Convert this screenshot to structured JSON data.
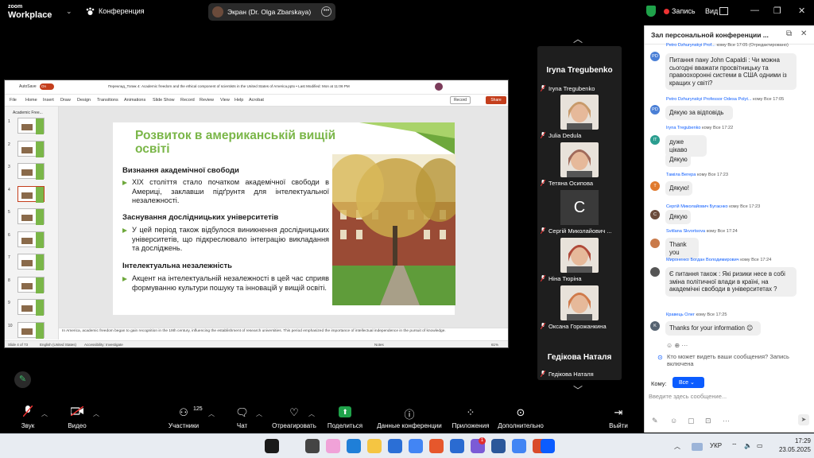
{
  "zoom": {
    "logo_top": "zoom",
    "logo_bottom": "Workplace",
    "meeting_label": "Конференция",
    "screen_share_label": "Экран (Dr. Olga Zbarskaya)",
    "recording_label": "Запись",
    "view_label": "Вид",
    "colors": {
      "accent": "#0b5cff",
      "green": "#1fa24a",
      "record": "#e33333"
    }
  },
  "powerpoint": {
    "autosave": "AutoSave",
    "autosave_state": "On",
    "file_title": "Переклад_Топик 4: Academic freedom and the ethical component of scientists in the United States of America.pptx • Last Modified: Mon at 11:06 PM",
    "menu": [
      "File",
      "Home",
      "Insert",
      "Draw",
      "Design",
      "Transitions",
      "Animations",
      "Slide Show",
      "Record",
      "Review",
      "View",
      "Help",
      "Acrobat"
    ],
    "record_btn": "Record",
    "share_btn": "Share",
    "pane_title": "Academic Free...",
    "slide_numbers": [
      "1",
      "2",
      "3",
      "4",
      "5",
      "6",
      "7",
      "8",
      "9",
      "10"
    ],
    "selected_slide": 4,
    "notes": "In America, academic freedom began to gain recognition in the 19th century, influencing the establishment of research universities. This period emphasized the importance of intellectual independence in the pursuit of knowledge.",
    "status_left": "Slide 4 of 73",
    "status_lang": "English (United States)",
    "status_access": "Accessibility: Investigate",
    "status_notes": "Notes",
    "zoom_pct": "61%",
    "slide": {
      "title": "Розвиток в американській вищій освіті",
      "h1": "Визнання академічної свободи",
      "p1": "ХІХ століття стало початком академічної свободи в Америці, заклавши підґрунтя для інтелектуальної незалежності.",
      "h2": "Заснування дослідницьких університетів",
      "p2": "У цей період також відбулося виникнення дослідницьких університетів, що підкреслювало інтеграцію викладання та досліджень.",
      "h3": "Інтелектуальна незалежність",
      "p3": "Акцент на інтелектуальній незалежності в цей час сприяв формуванню культури пошуку та інновацій у вищій освіті."
    }
  },
  "gallery": {
    "top_name": "Iryna Tregubenko",
    "tiles": [
      {
        "name": "Iryna Tregubenko"
      },
      {
        "name": "Julia Dedula"
      },
      {
        "name": "Тетяна Осипова"
      },
      {
        "name": "Сергій Миколайович ...",
        "initial": "С"
      },
      {
        "name": "Ніна Тюріна"
      },
      {
        "name": "Оксана Горожанкина"
      }
    ],
    "bottom_big": "Гедікова Наталя",
    "bottom_name": "Гедікова Наталя"
  },
  "chat": {
    "title": "Зал персональной конференции ...",
    "messages": [
      {
        "meta_name": "Petro Dzhurynskyi Prof...",
        "meta_rest": "кому Все 17:05 (Отредактировано)",
        "text": "Питання пану John Capaldi : Чи можна сьогодні вважати просвітницьку та правоохоронні системи в США одними із кращих у світі?",
        "avatar": "PD",
        "color": "#4a7fd6"
      },
      {
        "meta_name": "Petro Dzhurynskyi Professor Odesa Polyt...",
        "meta_rest": "кому Все 17:05",
        "text": "Дякую за відповідь",
        "avatar": "PD",
        "color": "#4a7fd6"
      },
      {
        "meta_name": "Iryna Tregubenko",
        "meta_rest": "кому Все 17:22",
        "text": "дуже цікаво",
        "avatar": "IT",
        "color": "#2a9d8f"
      },
      {
        "meta_name": "",
        "meta_rest": "",
        "text": "Дякую",
        "avatar": "",
        "color": ""
      },
      {
        "meta_name": "Таміла Вегера",
        "meta_rest": "кому Все 17:23",
        "text": "Дякую!",
        "avatar": "T",
        "color": "#e07a2e"
      },
      {
        "meta_name": "Сергій Миколайович Бугаєнко",
        "meta_rest": "кому Все 17:23",
        "text": "Дякую",
        "avatar": "C",
        "color": "#6b4b3b"
      },
      {
        "meta_name": "Svitlana Skvortsova",
        "meta_rest": "кому Все 17:24",
        "text": "Thank you",
        "avatar": "",
        "color": "#c97a4a"
      },
      {
        "meta_name": "Мироненко Богдан Володимирович",
        "meta_rest": "кому Все 17:24",
        "text": "Є питання також : Які ризики несе в собі зміна політичної влади в країні, на академічні свободи в університетах ?",
        "avatar": "",
        "color": "#555555"
      },
      {
        "meta_name": "Кравець Олег",
        "meta_rest": "кому Все 17:25",
        "text": "Thanks for your information 😊",
        "avatar": "K",
        "color": "#556270"
      }
    ],
    "who_sees": "Кто может видеть ваши сообщения? Запись включена",
    "to_label": "Кому:",
    "to_value": "Все",
    "placeholder": "Введите здесь сообщение..."
  },
  "toolbar": {
    "audio": "Звук",
    "video": "Видео",
    "participants": "Участники",
    "participants_count": "125",
    "chat": "Чат",
    "react": "Отреагировать",
    "share": "Поделиться",
    "info": "Данные конференции",
    "apps": "Приложения",
    "more": "Дополнительно",
    "leave": "Выйти"
  },
  "taskbar": {
    "lang": "УКР",
    "time": "17:29",
    "date": "23.05.2025",
    "badge": "1"
  }
}
